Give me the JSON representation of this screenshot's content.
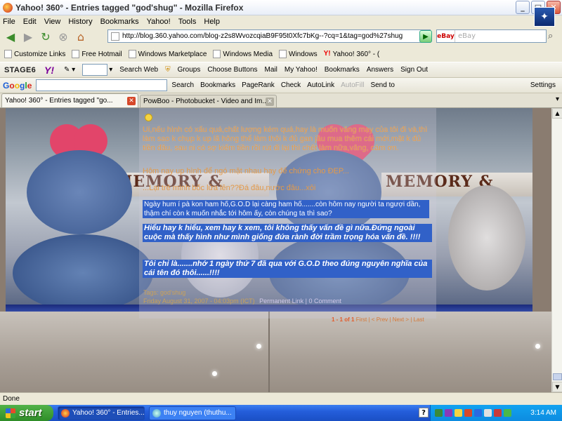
{
  "window": {
    "title": "Yahoo! 360° - Entries tagged \"god'shug\" - Mozilla Firefox",
    "buttons": {
      "min": "_",
      "max": "□",
      "close": "✕"
    }
  },
  "menu": [
    "File",
    "Edit",
    "View",
    "History",
    "Bookmarks",
    "Yahoo!",
    "Tools",
    "Help"
  ],
  "nav": {
    "url": "http://blog.360.yahoo.com/blog-z2s8WvozcqiaB9F95t0Xfc7bKg--?cq=1&tag=god%27shug",
    "search_engine": "eBay",
    "search_placeholder": "eBay"
  },
  "bookmarks": [
    "Customize Links",
    "Free Hotmail",
    "Windows Marketplace",
    "Windows Media",
    "Windows",
    "Yahoo! 360° - ("
  ],
  "yahoo_toolbar": {
    "stage6": "STAGE6",
    "logo": "Y!",
    "items": [
      "Search Web",
      "Groups",
      "Choose Buttons",
      "Mail",
      "My Yahoo!",
      "Bookmarks",
      "Answers",
      "Sign Out"
    ]
  },
  "google_toolbar": {
    "logo": [
      "G",
      "o",
      "o",
      "g",
      "l",
      "e"
    ],
    "items": [
      "Search",
      "Bookmarks",
      "PageRank",
      "Check",
      "AutoLink",
      "AutoFill",
      "Send to",
      "Settings"
    ]
  },
  "tabs": [
    {
      "label": "Yahoo! 360° - Entries tagged \"go...",
      "active": true
    },
    {
      "label": "PowBoo - Photobucket - Video and Im...",
      "active": false
    }
  ],
  "post": {
    "line1": "Ui,nếu hình có xấu quá,chất lượng kém quá,hay là muốn văng mạy của tôi đi và,thì làm sao k chụp k up lã hông thể làm thôi k đủ gan jầu mua thêm cái mới,mặt k đủ tiền đâu, sau ni có sợ kiếm tiền rồi rút đi lại thì chết làm nữa,vâng, cám ơn.",
    "line2": "Hôm nay up hình để ngó mặt nhau hay để chứng cho ĐẸP...",
    "line3": "...Lại trẻ mình bốc lửa lên??Đá đâu,nước đâu...xôi",
    "hl1": "Ngày hum í pà kon ham hố,G.O.D lại càng ham hố.......còn hôm nay người ta ngượi dần, thậm chí còn k muốn nhắc tới hôm ấy, còn chúng ta thì sao?",
    "hl2": "Hiểu hay k hiểu, xem hay k xem, tôi không thấy vấn đề gì nữa.Đứng ngoài cuộc mà thấy hình như mình giống đứa rành đời trầm trọng hóa vấn đề. !!!!",
    "hl3": "Tôi chỉ là.......nhớ 1 ngày thứ 7 đã qua với G.O.D theo đúng nguyên nghĩa của cái tên đó thôi......!!!!",
    "tags": "Tags: god'shug",
    "date": "Friday August 31, 2007 - 04:03pm (ICT)",
    "permalink": "Permanent Link | 0 Comment"
  },
  "pager": {
    "range": "1 - 1 of 1",
    "first": "First",
    "prev": "< Prev",
    "next": "Next >",
    "last": "Last"
  },
  "status": "Done",
  "taskbar": {
    "start": "start",
    "items": [
      {
        "label": "Yahoo! 360° - Entries...",
        "active": true
      },
      {
        "label": "thuy nguyen (thuthu...",
        "active": false
      }
    ],
    "clock": "3:14 AM"
  }
}
